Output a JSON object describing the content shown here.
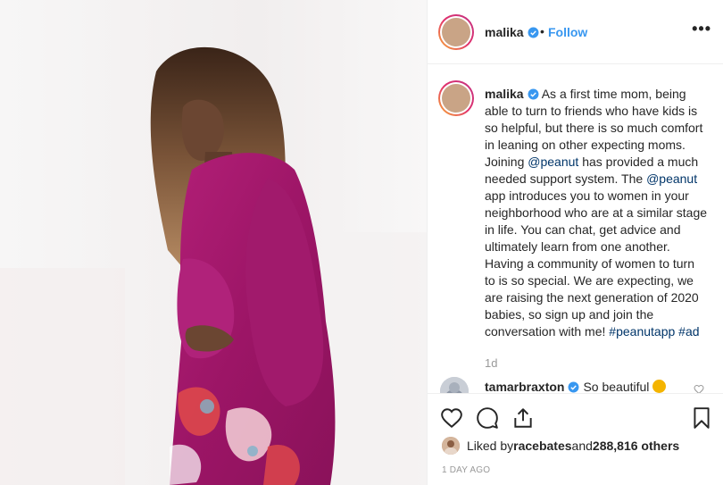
{
  "post": {
    "username": "malika",
    "follow_label": "Follow",
    "separator": "•",
    "more_label": "•••"
  },
  "caption": {
    "username": "malika",
    "parts": {
      "p1": " As a first time mom, being able to turn to friends who have kids is so helpful, but there is so much comfort in leaning on other expecting moms. Joining ",
      "m1": "@peanut",
      "p2": " has provided a much needed support system. The ",
      "m2": "@peanut",
      "p3": " app introduces you to women in your neighborhood who are at a similar stage in life. You can chat, get advice and ultimately learn from one another. Having a community of women to turn to is so special. We are expecting, we are raising the next generation of 2020 babies, so sign up and join the conversation with me! ",
      "h1": "#peanutapp",
      "h2": "#ad"
    },
    "age": "1d"
  },
  "comment": {
    "username": "tamarbraxton",
    "text": "So beautiful"
  },
  "likes": {
    "prefix": "Liked by ",
    "user": "racebates",
    "middle": " and ",
    "others": "288,816 others"
  },
  "timestamp": "1 DAY AGO",
  "colors": {
    "accent": "#3897f0",
    "mention": "#003569",
    "verified": "#3897f0",
    "muted": "#999999",
    "robe": "#a0176b"
  },
  "icons": [
    "verified-icon",
    "heart-icon",
    "comment-icon",
    "share-icon",
    "bookmark-icon"
  ]
}
